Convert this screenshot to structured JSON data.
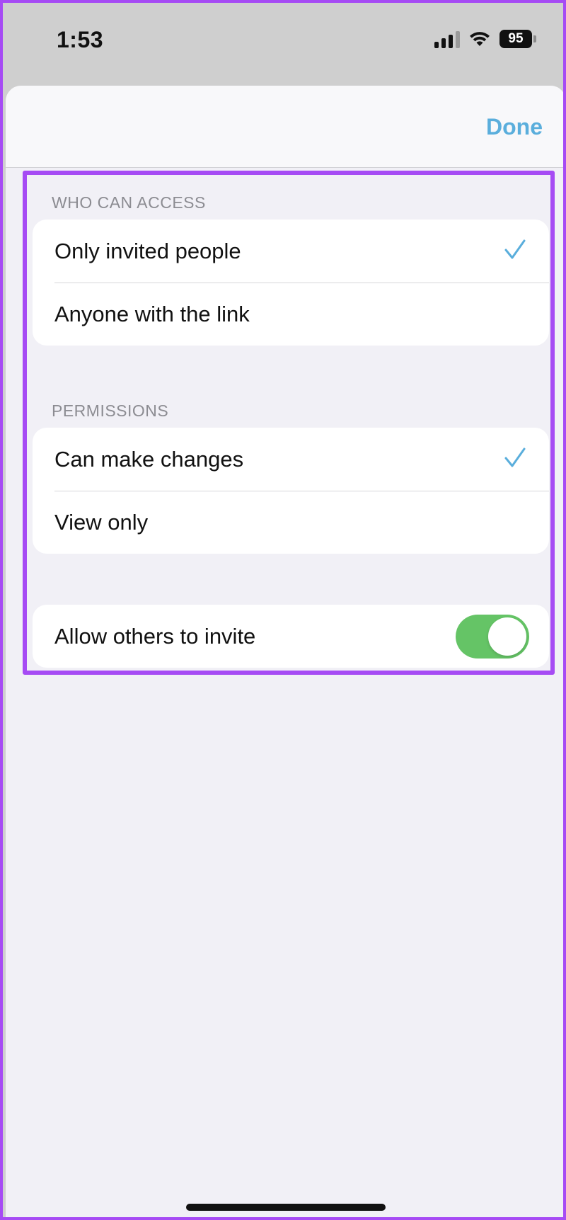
{
  "status_bar": {
    "time": "1:53",
    "battery": "95"
  },
  "header": {
    "done_label": "Done"
  },
  "who_can_access": {
    "header": "WHO CAN ACCESS",
    "options": [
      {
        "label": "Only invited people",
        "selected": true
      },
      {
        "label": "Anyone with the link",
        "selected": false
      }
    ]
  },
  "permissions": {
    "header": "PERMISSIONS",
    "options": [
      {
        "label": "Can make changes",
        "selected": true
      },
      {
        "label": "View only",
        "selected": false
      }
    ]
  },
  "invite": {
    "label": "Allow others to invite",
    "enabled": true
  },
  "colors": {
    "accent": "#5aaedc",
    "toggle_on": "#65c466",
    "highlight": "#a64bf4"
  }
}
